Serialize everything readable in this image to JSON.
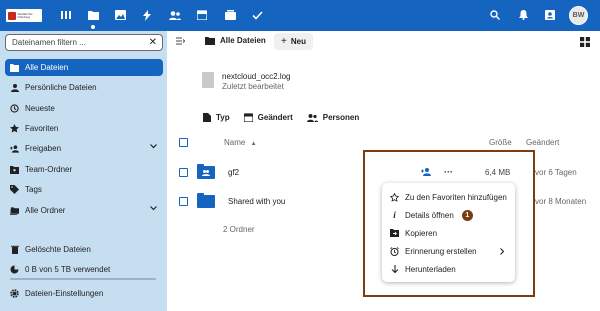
{
  "topbar": {
    "logo_text": "Stadtarchiv Nürnberg",
    "apps": [
      {
        "name": "dashboard-icon"
      },
      {
        "name": "files-icon"
      },
      {
        "name": "photos-icon"
      },
      {
        "name": "activity-icon"
      },
      {
        "name": "contacts-icon"
      },
      {
        "name": "calendar-icon"
      },
      {
        "name": "deck-icon"
      },
      {
        "name": "tasks-icon"
      }
    ],
    "avatar": "BW"
  },
  "sidebar": {
    "filter_placeholder": "Dateinamen filtern ...",
    "items": [
      {
        "label": "Alle Dateien"
      },
      {
        "label": "Persönliche Dateien"
      },
      {
        "label": "Neueste"
      },
      {
        "label": "Favoriten"
      },
      {
        "label": "Freigaben"
      },
      {
        "label": "Team-Ordner"
      },
      {
        "label": "Tags"
      },
      {
        "label": "Alle Ordner"
      }
    ],
    "deleted": "Gelöschte Dateien",
    "quota": "0 B von 5 TB verwendet",
    "quota_fraction": 0,
    "settings": "Dateien-Einstellungen"
  },
  "main": {
    "breadcrumb": "Alle Dateien",
    "new_button": "Neu",
    "recent": {
      "name": "nextcloud_occ2.log",
      "subtitle": "Zuletzt bearbeitet"
    },
    "filters": [
      "Typ",
      "Geändert",
      "Personen"
    ],
    "columns": {
      "name": "Name",
      "size": "Größe",
      "modified": "Geändert"
    },
    "rows": [
      {
        "name": "gf2",
        "size": "6,4 MB",
        "modified": "vor 6 Tagen"
      },
      {
        "name": "Shared with you",
        "size": "",
        "modified": "vor 8 Monaten"
      }
    ],
    "summary": "2 Ordner"
  },
  "context_menu": {
    "items": [
      {
        "label": "Zu den Favoriten hinzufügen"
      },
      {
        "label": "Details öffnen"
      },
      {
        "label": "Kopieren"
      },
      {
        "label": "Erinnerung erstellen"
      },
      {
        "label": "Herunterladen"
      }
    ],
    "annotation_badge": "1"
  },
  "colors": {
    "accent": "#1565c0",
    "sidebar": "#c6dff0",
    "annotation": "#7a3c13"
  }
}
